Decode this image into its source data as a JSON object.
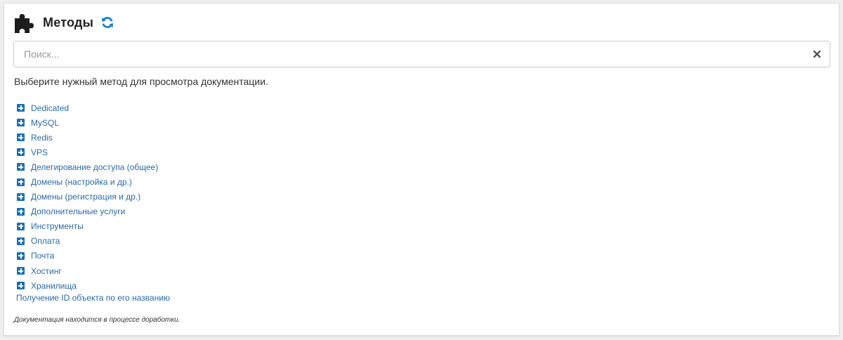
{
  "header": {
    "title": "Методы",
    "icon": "puzzle-piece-icon",
    "refresh_icon": "refresh-icon"
  },
  "search": {
    "value": "",
    "placeholder": "Поиск...",
    "clear_icon": "close-icon"
  },
  "intro_text": "Выберите нужный метод для просмотра документации.",
  "tree": {
    "expand_icon": "plus-square-icon",
    "items": [
      {
        "label": "Dedicated"
      },
      {
        "label": "MySQL"
      },
      {
        "label": "Redis"
      },
      {
        "label": "VPS"
      },
      {
        "label": "Делегирование доступа (общее)"
      },
      {
        "label": "Домены (настройка и др.)"
      },
      {
        "label": "Домены (регистрация и др.)"
      },
      {
        "label": "Дополнительные услуги"
      },
      {
        "label": "Инструменты"
      },
      {
        "label": "Оплата"
      },
      {
        "label": "Почта"
      },
      {
        "label": "Хостинг"
      },
      {
        "label": "Хранилища"
      }
    ]
  },
  "lookup_link": "Получение ID объекта по его названию",
  "footnote": "Документация находится в процессе доработки.",
  "colors": {
    "link": "#2a6aa8",
    "icon_blue": "#1a6fb3",
    "text": "#333333"
  }
}
